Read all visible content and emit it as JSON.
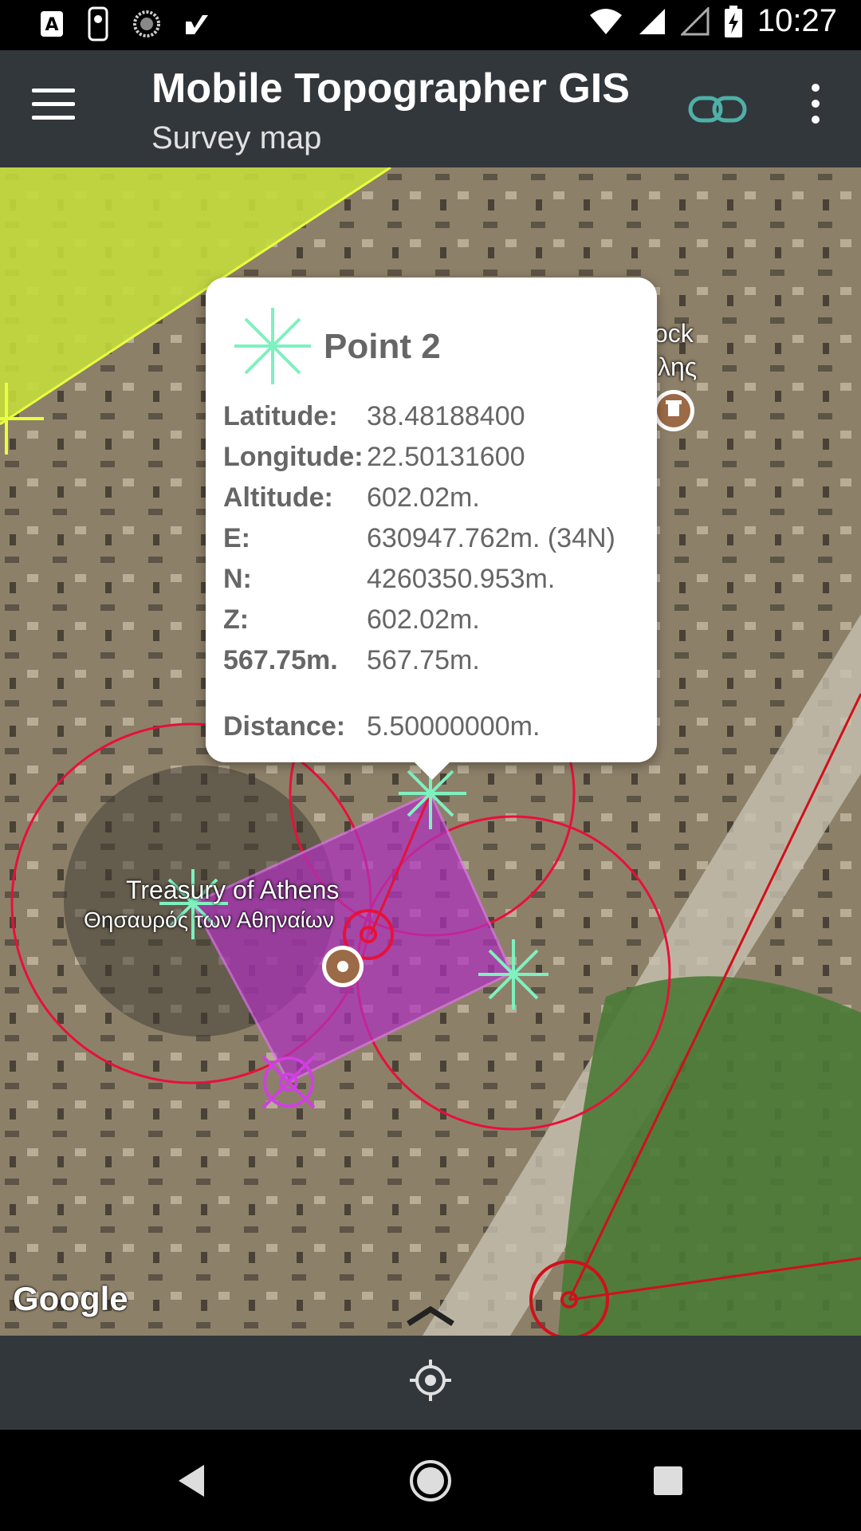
{
  "status_bar": {
    "time": "10:27"
  },
  "app_bar": {
    "title": "Mobile Topographer GIS",
    "subtitle": "Survey map"
  },
  "map": {
    "labels": {
      "treasury_en": "Treasury of Athens",
      "treasury_gr": "Θησαυρός των Αθηναίων",
      "rock_en": "ock",
      "rock_gr": "λης"
    },
    "attribution": "Google"
  },
  "popup": {
    "title": "Point 2",
    "rows": [
      {
        "key": "Latitude:",
        "value": "38.48188400"
      },
      {
        "key": "Longitude:",
        "value": "22.50131600"
      },
      {
        "key": "Altitude:",
        "value": "602.02m."
      },
      {
        "key": "E:",
        "value": "630947.762m. (34N)"
      },
      {
        "key": "N:",
        "value": "4260350.953m."
      },
      {
        "key": "Z:",
        "value": "602.02m."
      },
      {
        "key": "567.75m.",
        "value": "567.75m."
      },
      {
        "key": "Distance:",
        "value": "5.50000000m."
      }
    ]
  },
  "colors": {
    "app_bar": "#32373c",
    "point_marker": "#7ff0c0",
    "polygon": "#b030c0",
    "circle": "#e8103a",
    "link_icon": "#4fb0a8"
  },
  "icons": {
    "menu": "hamburger-icon",
    "link": "link-icon",
    "more": "more-vert-icon",
    "locate": "my-location-icon",
    "back": "nav-back-icon",
    "home": "nav-home-icon",
    "recents": "nav-recents-icon"
  }
}
